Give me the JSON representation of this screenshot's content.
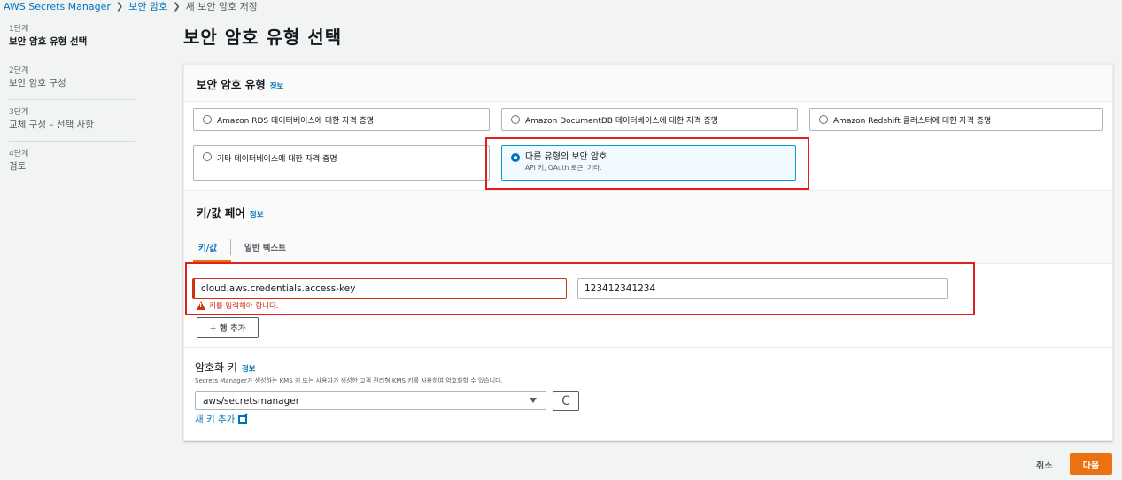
{
  "breadcrumb": {
    "items": [
      "AWS Secrets Manager",
      "보안 암호",
      "새 보안 암호 저장"
    ]
  },
  "steps": [
    {
      "num": "1단계",
      "label": "보안 암호 유형 선택"
    },
    {
      "num": "2단계",
      "label": "보안 암호 구성"
    },
    {
      "num": "3단계",
      "label": "교체 구성 – 선택 사항"
    },
    {
      "num": "4단계",
      "label": "검토"
    }
  ],
  "page_title": "보안 암호 유형 선택",
  "secret_type": {
    "heading": "보안 암호 유형",
    "info": "정보",
    "options": [
      "Amazon RDS 데이터베이스에 대한 자격 증명",
      "Amazon DocumentDB 데이터베이스에 대한 자격 증명",
      "Amazon Redshift 클러스터에 대한 자격 증명",
      "기타 데이터베이스에 대한 자격 증명"
    ],
    "selected": {
      "title": "다른 유형의 보안 암호",
      "desc": "API 키, OAuth 토큰, 기타."
    }
  },
  "kv": {
    "heading": "키/값 페어",
    "info": "정보",
    "tabs": [
      "키/값",
      "일반 텍스트"
    ],
    "key_value": "cloud.aws.credentials.access-key",
    "value_value": "123412341234",
    "error": "키를 입력해야 합니다.",
    "add_row": "+ 행 추가"
  },
  "encryption": {
    "heading": "암호화 키",
    "info": "정보",
    "description": "Secrets Manager가 생성하는 KMS 키 또는 사용자가 생성한 고객 관리형 KMS 키를 사용하여 암호화할 수 있습니다.",
    "selected": "aws/secretsmanager",
    "refresh_glyph": "C",
    "new_key": "새 키 추가"
  },
  "footer": {
    "cancel": "취소",
    "next": "다음"
  },
  "colors": {
    "accent": "#ec7211",
    "link": "#0073bb",
    "error": "#d13212",
    "highlight": "#e02020"
  }
}
